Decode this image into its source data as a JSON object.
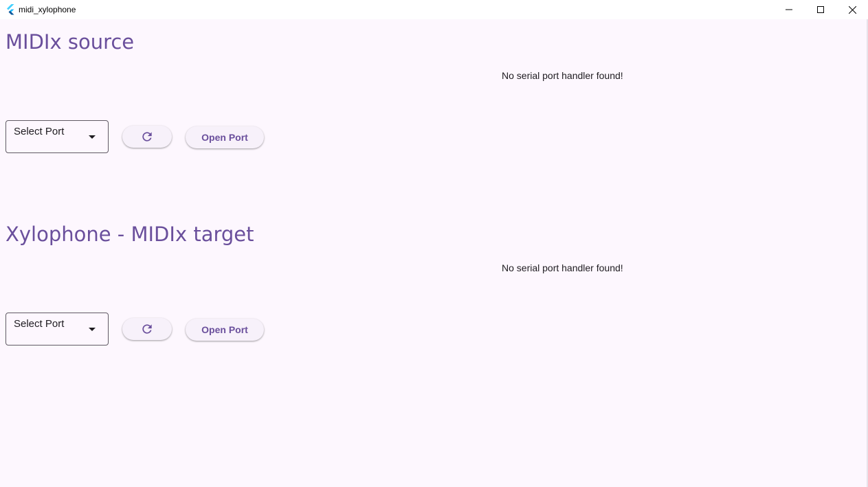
{
  "window": {
    "title": "midi_xylophone",
    "controls": [
      "minimize-icon",
      "maximize-icon",
      "close-icon"
    ]
  },
  "colors": {
    "background": "#fdf7fe",
    "accent": "#6a4f9c",
    "button_bg": "#f7f1fa",
    "text": "#1e1b20"
  },
  "sections": [
    {
      "title": "MIDIx source",
      "status": "No serial port handler found!",
      "port_select": {
        "value": "Select Port"
      },
      "refresh_icon": "refresh-icon",
      "open_button_label": "Open Port"
    },
    {
      "title": "Xylophone - MIDIx target",
      "status": "No serial port handler found!",
      "port_select": {
        "value": "Select Port"
      },
      "refresh_icon": "refresh-icon",
      "open_button_label": "Open Port"
    }
  ]
}
